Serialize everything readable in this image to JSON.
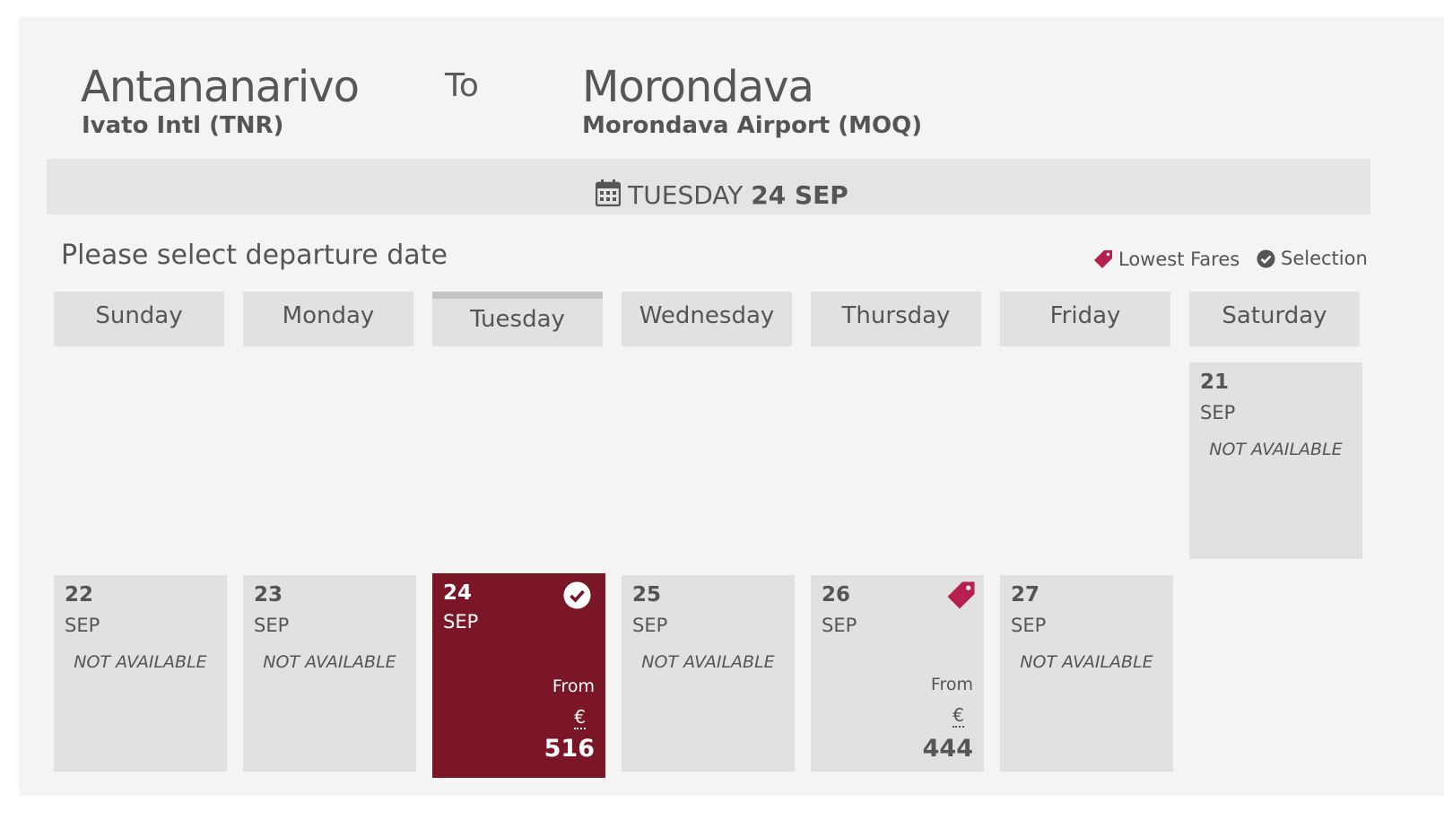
{
  "route": {
    "origin_city": "Antananarivo",
    "origin_airport": "Ivato Intl (TNR)",
    "to_label": "To",
    "destination_city": "Morondava",
    "destination_airport": "Morondava Airport (MOQ)"
  },
  "selected_date": {
    "weekday": "TUESDAY",
    "day_month": "24 SEP",
    "icon": "calendar-icon"
  },
  "prompt": "Please select departure date",
  "legend": {
    "lowest_fares": "Lowest Fares",
    "selection": "Selection",
    "lowest_fares_icon": "price-tag-icon",
    "selection_icon": "check-circle-icon"
  },
  "weekdays": [
    "Sunday",
    "Monday",
    "Tuesday",
    "Wednesday",
    "Thursday",
    "Friday",
    "Saturday"
  ],
  "active_weekday": "Tuesday",
  "days": [
    {
      "day": "21",
      "month": "SEP",
      "status": "NOT AVAILABLE"
    },
    {
      "day": "22",
      "month": "SEP",
      "status": "NOT AVAILABLE"
    },
    {
      "day": "23",
      "month": "SEP",
      "status": "NOT AVAILABLE"
    },
    {
      "day": "24",
      "month": "SEP",
      "from": "From",
      "currency": "€",
      "price": "516",
      "selected": true
    },
    {
      "day": "25",
      "month": "SEP",
      "status": "NOT AVAILABLE"
    },
    {
      "day": "26",
      "month": "SEP",
      "from": "From",
      "currency": "€",
      "price": "444",
      "lowest_fare": true
    },
    {
      "day": "27",
      "month": "SEP",
      "status": "NOT AVAILABLE"
    }
  ],
  "colors": {
    "selected": "#7a1626",
    "tag": "#b5204f",
    "cell": "#e1e1e1",
    "panel": "#f4f4f4"
  }
}
